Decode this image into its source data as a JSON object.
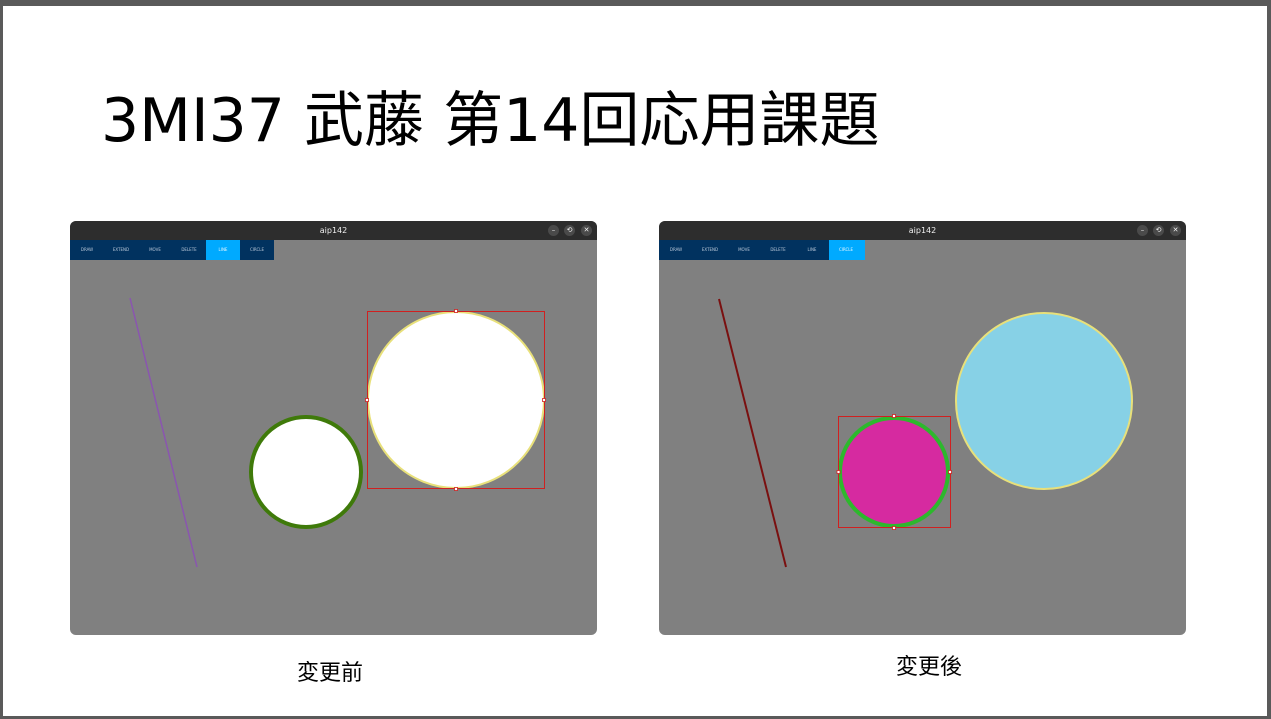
{
  "slide": {
    "title": "3MI37 武藤 第14回応用課題"
  },
  "windows": [
    {
      "title": "aip142",
      "caption": "変更前",
      "toolbar": [
        {
          "label": "DRAW",
          "active": false
        },
        {
          "label": "EXTEND",
          "active": false
        },
        {
          "label": "MOVE",
          "active": false
        },
        {
          "label": "DELETE",
          "active": false
        },
        {
          "label": "LINE",
          "active": true
        },
        {
          "label": "CIRCLE",
          "active": false
        }
      ],
      "controls": {
        "minimize": "–",
        "maximize": "⟲",
        "close": "✕"
      }
    },
    {
      "title": "aip142",
      "caption": "変更後",
      "toolbar": [
        {
          "label": "DRAW",
          "active": false
        },
        {
          "label": "EXTEND",
          "active": false
        },
        {
          "label": "MOVE",
          "active": false
        },
        {
          "label": "DELETE",
          "active": false
        },
        {
          "label": "LINE",
          "active": false
        },
        {
          "label": "CIRCLE",
          "active": true
        }
      ],
      "controls": {
        "minimize": "–",
        "maximize": "⟲",
        "close": "✕"
      }
    }
  ],
  "colors": {
    "canvas_bg": "#808080",
    "toolbar_bg": "#01325f",
    "toolbar_active": "#00aaff",
    "titlebar_bg": "#2d2d2d",
    "before_line": "#8a55b0",
    "before_small_circle_fill": "#ffffff",
    "before_small_circle_stroke": "#3f7a0a",
    "before_big_circle_fill": "#ffffff",
    "before_big_circle_stroke": "#e8e07a",
    "after_line": "#7a1010",
    "after_small_circle_fill": "#d62aa0",
    "after_small_circle_stroke": "#2db82d",
    "after_big_circle_fill": "#87d1e6",
    "after_big_circle_stroke": "#e8e07a",
    "selection": "#d02020"
  }
}
